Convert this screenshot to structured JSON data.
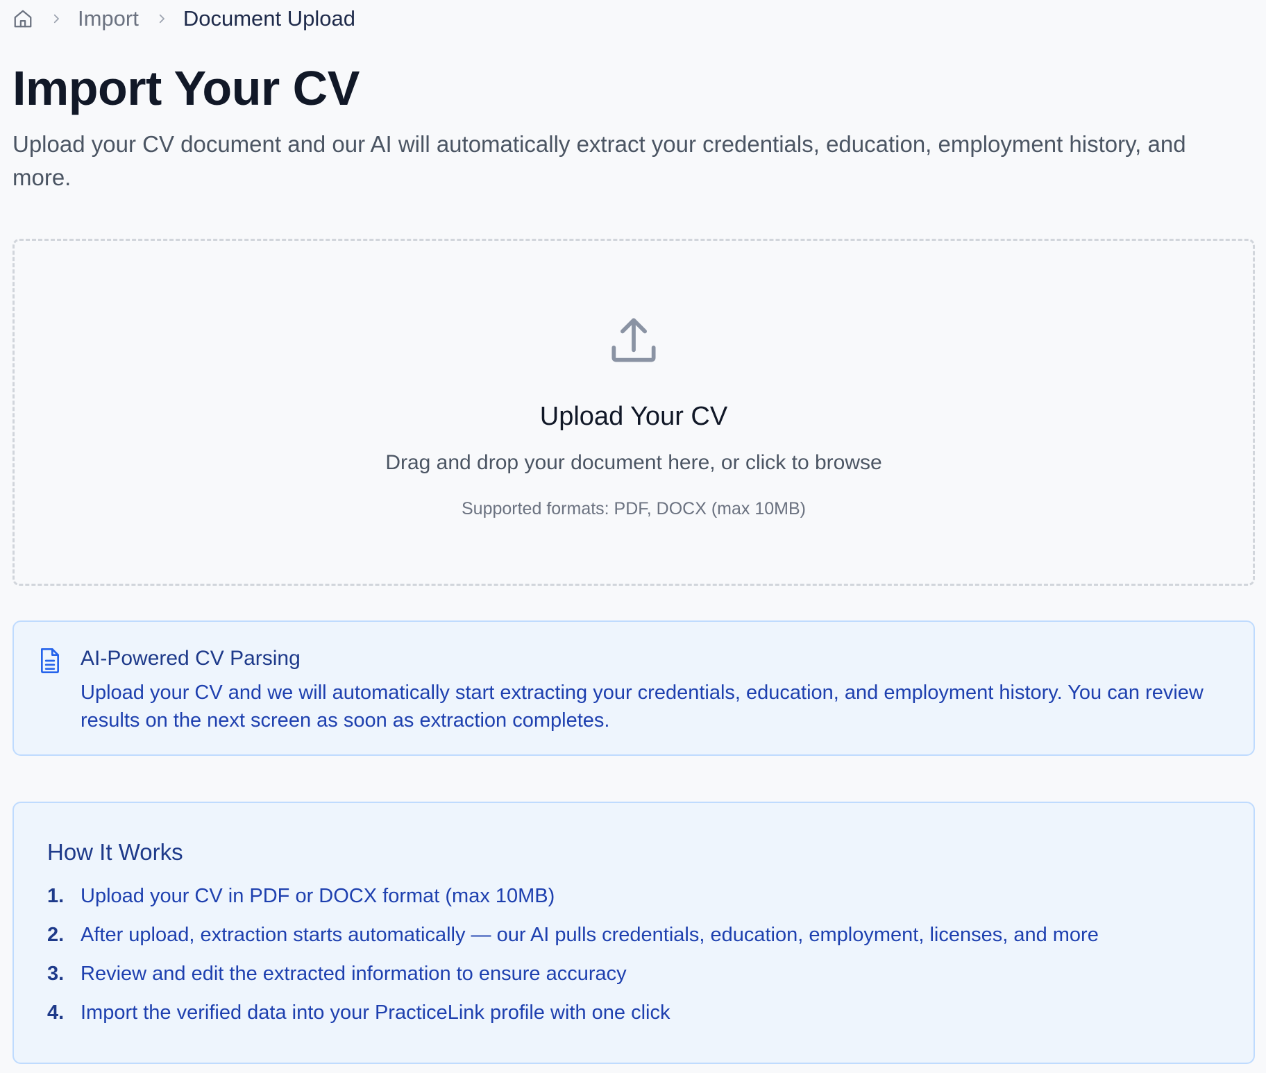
{
  "breadcrumb": {
    "home_icon": "home-icon",
    "items": [
      {
        "label": "Import"
      },
      {
        "label": "Document Upload"
      }
    ]
  },
  "header": {
    "title": "Import Your CV",
    "subtitle": "Upload your CV document and our AI will automatically extract your credentials, education, employment history, and more."
  },
  "upload": {
    "icon": "upload-icon",
    "title": "Upload Your CV",
    "hint": "Drag and drop your document here, or click to browse",
    "formats": "Supported formats: PDF, DOCX (max 10MB)"
  },
  "info": {
    "icon": "document-icon",
    "title": "AI-Powered CV Parsing",
    "text": "Upload your CV and we will automatically start extracting your credentials, education, and employment history. You can review results on the next screen as soon as extraction completes."
  },
  "how_it_works": {
    "title": "How It Works",
    "steps": [
      {
        "number": "1.",
        "text": "Upload your CV in PDF or DOCX format (max 10MB)"
      },
      {
        "number": "2.",
        "text": "After upload, extraction starts automatically — our AI pulls credentials, education, employment, licenses, and more"
      },
      {
        "number": "3.",
        "text": "Review and edit the extracted information to ensure accuracy"
      },
      {
        "number": "4.",
        "text": "Import the verified data into your PracticeLink profile with one click"
      }
    ]
  },
  "colors": {
    "background": "#f8f9fb",
    "accent": "#2563eb",
    "info_background": "#eef5fd",
    "info_border": "#bfdbfe",
    "info_text": "#1e40af"
  }
}
